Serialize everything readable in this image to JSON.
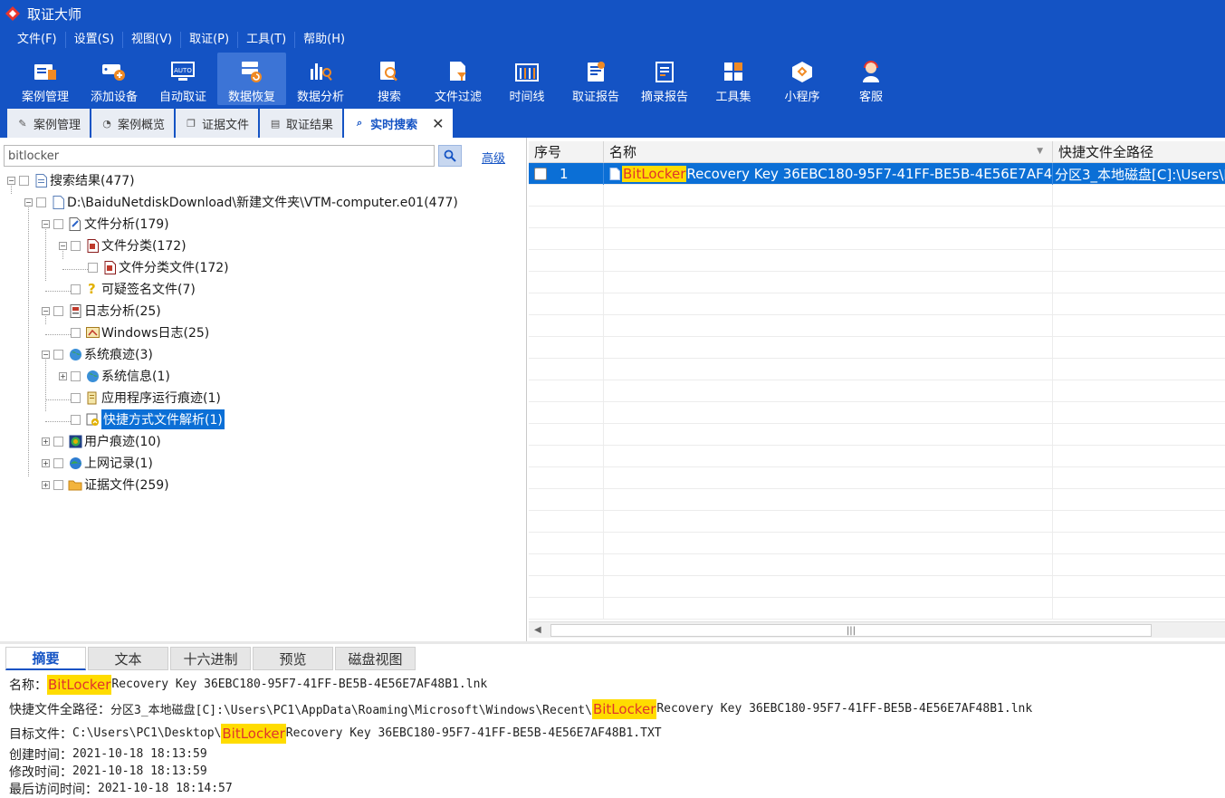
{
  "app": {
    "title": "取证大师"
  },
  "menu": [
    "文件(F)",
    "设置(S)",
    "视图(V)",
    "取证(P)",
    "工具(T)",
    "帮助(H)"
  ],
  "toolbar": [
    {
      "label": "案例管理",
      "icon": "case-folder-icon"
    },
    {
      "label": "添加设备",
      "icon": "add-device-icon"
    },
    {
      "label": "自动取证",
      "icon": "auto-forensic-icon"
    },
    {
      "label": "数据恢复",
      "icon": "data-recovery-icon",
      "active": true
    },
    {
      "label": "数据分析",
      "icon": "data-analysis-icon"
    },
    {
      "label": "搜索",
      "icon": "search-doc-icon"
    },
    {
      "label": "文件过滤",
      "icon": "file-filter-icon"
    },
    {
      "label": "时间线",
      "icon": "timeline-icon"
    },
    {
      "label": "取证报告",
      "icon": "forensic-report-icon"
    },
    {
      "label": "摘录报告",
      "icon": "excerpt-report-icon"
    },
    {
      "label": "工具集",
      "icon": "toolkit-icon"
    },
    {
      "label": "小程序",
      "icon": "mini-program-icon"
    },
    {
      "label": "客服",
      "icon": "customer-service-icon"
    }
  ],
  "tabs": [
    "案例管理",
    "案例概览",
    "证据文件",
    "取证结果",
    "实时搜索"
  ],
  "search": {
    "value": "bitlocker",
    "advanced_label": "高级"
  },
  "tree": [
    {
      "label": "搜索结果(477)"
    },
    {
      "label": "D:\\BaiduNetdiskDownload\\新建文件夹\\VTM-computer.e01(477)"
    },
    {
      "label": "文件分析(179)"
    },
    {
      "label": "文件分类(172)"
    },
    {
      "label": "文件分类文件(172)"
    },
    {
      "label": "可疑签名文件(7)"
    },
    {
      "label": "日志分析(25)"
    },
    {
      "label": "Windows日志(25)"
    },
    {
      "label": "系统痕迹(3)"
    },
    {
      "label": "系统信息(1)"
    },
    {
      "label": "应用程序运行痕迹(1)"
    },
    {
      "label": "快捷方式文件解析(1)"
    },
    {
      "label": "用户痕迹(10)"
    },
    {
      "label": "上网记录(1)"
    },
    {
      "label": "证据文件(259)"
    }
  ],
  "grid": {
    "columns": [
      "序号",
      "名称",
      "快捷文件全路径"
    ],
    "rows": [
      {
        "index": "1",
        "name_highlight": "BitLocker",
        "name_rest": " Recovery Key 36EBC180-95F7-41FF-BE5B-4E56E7AF4...",
        "path": "分区3_本地磁盘[C]:\\Users\\P"
      }
    ]
  },
  "bottom_tabs": [
    "摘要",
    "文本",
    "十六进制",
    "预览",
    "磁盘视图"
  ],
  "detail": {
    "name_label": "名称：",
    "name_hl": "BitLocker",
    "name_rest": " Recovery Key 36EBC180-95F7-41FF-BE5B-4E56E7AF48B1.lnk",
    "path_label": "快捷文件全路径：",
    "path_pre": "分区3_本地磁盘[C]:\\Users\\PC1\\AppData\\Roaming\\Microsoft\\Windows\\Recent\\",
    "path_hl": "BitLocker",
    "path_rest": " Recovery Key 36EBC180-95F7-41FF-BE5B-4E56E7AF48B1.lnk",
    "target_label": "目标文件：",
    "target_pre": "C:\\Users\\PC1\\Desktop\\",
    "target_hl": "BitLocker",
    "target_rest": " Recovery Key 36EBC180-95F7-41FF-BE5B-4E56E7AF48B1.TXT",
    "created_label": "创建时间：",
    "created": "2021-10-18 18:13:59",
    "modified_label": "修改时间：",
    "modified": "2021-10-18 18:13:59",
    "accessed_label": "最后访问时间：",
    "accessed": "2021-10-18 18:14:57"
  },
  "colors": {
    "brand": "#1453c4",
    "selection": "#0b6fd6",
    "highlight": "#ffdc00",
    "highlight_text": "#e0352b"
  }
}
